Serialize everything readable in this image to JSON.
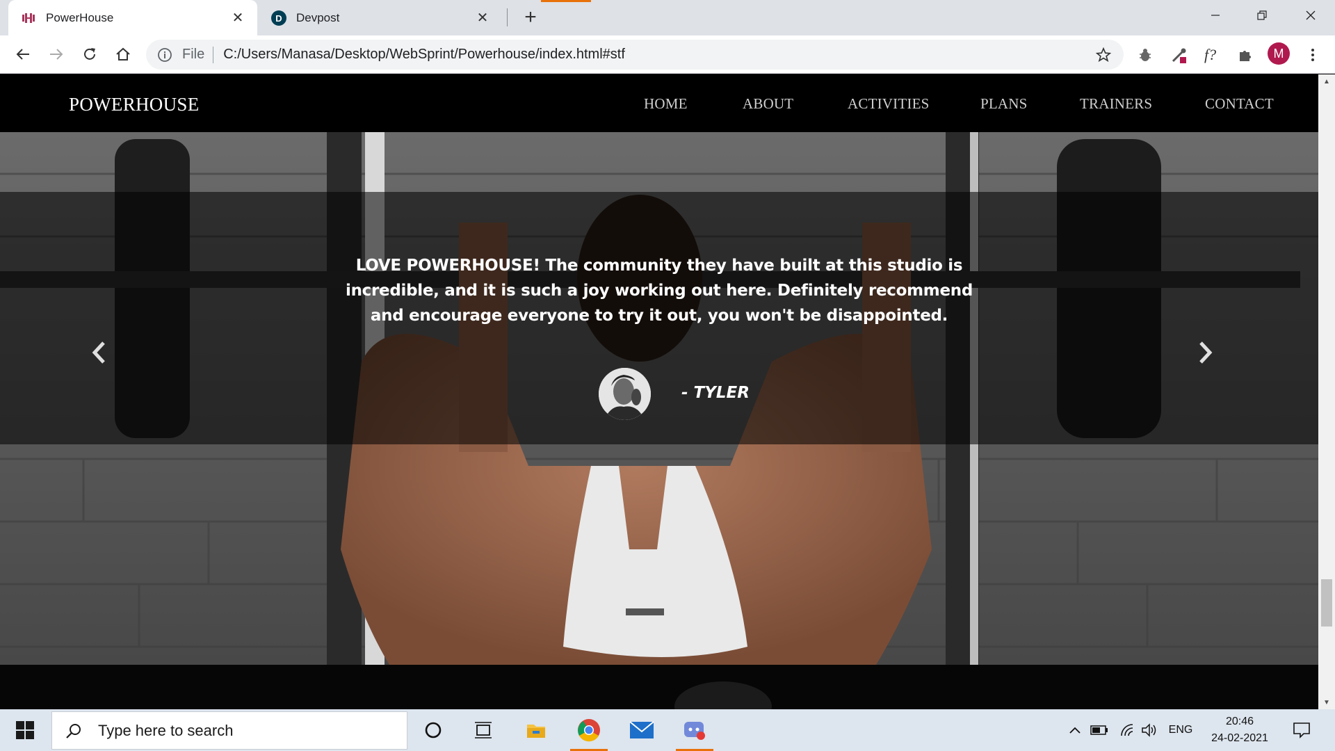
{
  "browser": {
    "tabs": [
      {
        "title": "PowerHouse",
        "active": true
      },
      {
        "title": "Devpost",
        "active": false
      }
    ],
    "address": {
      "scheme": "File",
      "url": "C:/Users/Manasa/Desktop/WebSprint/Powerhouse/index.html#stf"
    },
    "profile_initial": "M",
    "accent_color": "#e8710a"
  },
  "site": {
    "brand": "POWERHOUSE",
    "nav": [
      "HOME",
      "ABOUT",
      "ACTIVITIES",
      "PLANS",
      "TRAINERS",
      "CONTACT"
    ],
    "testimonial": {
      "quote": "LOVE POWERHOUSE! The community they have built at this studio is incredible, and it is such a joy working out here. Definitely recommend and encourage everyone to try it out, you won't be disappointed.",
      "author": "- TYLER"
    },
    "hero_image_desc_icon": "weightlifter-photo"
  },
  "taskbar": {
    "search_placeholder": "Type here to search",
    "language": "ENG",
    "time": "20:46",
    "date": "24-02-2021"
  }
}
